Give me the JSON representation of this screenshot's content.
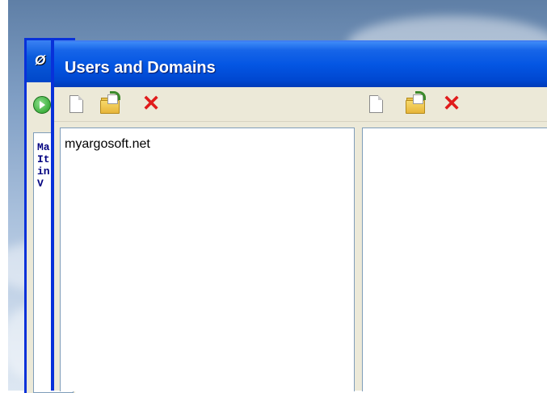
{
  "back_window": {
    "icon": "app-icon",
    "toolbar_icon": "go-icon",
    "text_lines": [
      "Ma",
      "It",
      "in",
      "V"
    ]
  },
  "window": {
    "title": "Users and Domains"
  },
  "left_toolbar": {
    "icons": [
      "new-icon",
      "open-folder-icon",
      "delete-icon"
    ]
  },
  "right_toolbar": {
    "icons": [
      "new-icon",
      "open-folder-icon",
      "delete-icon"
    ]
  },
  "domains_list": {
    "items": [
      {
        "label": "myargosoft.net"
      }
    ]
  },
  "colors": {
    "titlebar": "#0456e3",
    "window_face": "#ece9d8",
    "delete_red": "#e01b1b"
  }
}
